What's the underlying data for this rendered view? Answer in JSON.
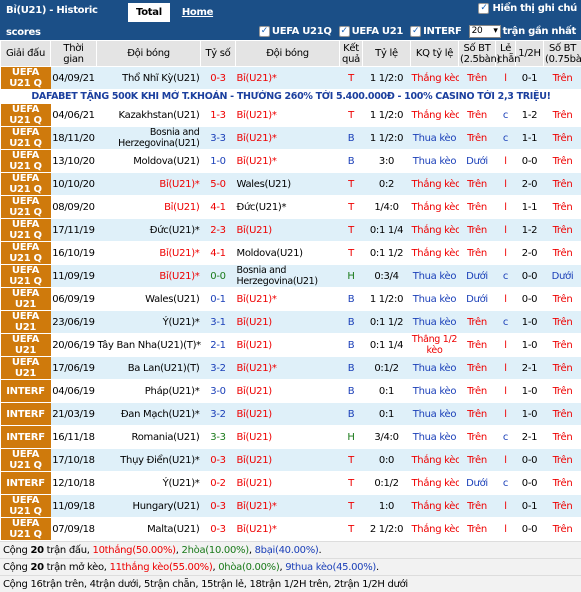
{
  "header": {
    "title": "Bỉ(U21) - Historic scores",
    "tab_total": "Total",
    "tab_home": "Home",
    "show_notes": "Hiển thị ghi chú"
  },
  "filters": {
    "f1": "UEFA U21Q",
    "f2": "UEFA U21",
    "f3": "INTERF",
    "count": "20",
    "count_suffix": "trận gần nhất"
  },
  "columns": [
    "Giải đấu",
    "Thời gian",
    "Đội bóng",
    "Tỷ số",
    "Đội bóng",
    "Kết quả",
    "Tỷ lệ",
    "KQ tỷ lệ",
    "Số BT (2.5bàn)",
    "Lẻ chẵn",
    "1/2H",
    "Số BT (0.75bàn)"
  ],
  "ad_text": "DAFABET TẶNG 500K KHI MỞ T.KHOẢN - THƯỞNG 260% TỚI 5.400.000Đ - 100% CASINO TỚI 2,3 TRIỆU!",
  "rows": [
    {
      "league": "UEFA U21 Q",
      "date": "04/09/21",
      "home": "Thổ Nhĩ Kỳ(U21)",
      "score": "0-3",
      "away": "Bỉ(U21)*",
      "res": "T",
      "odds": "1 1/2:0",
      "kq": "Thắng kèo",
      "bt": "Trên",
      "lc": "l",
      "h1": "0-1",
      "bt2": "Trên"
    },
    {
      "league": "UEFA U21 Q",
      "date": "04/06/21",
      "home": "Kazakhstan(U21)",
      "score": "1-3",
      "away": "Bỉ(U21)*",
      "res": "T",
      "odds": "1 1/2:0",
      "kq": "Thắng kèo",
      "bt": "Trên",
      "lc": "c",
      "h1": "1-2",
      "bt2": "Trên"
    },
    {
      "league": "UEFA U21 Q",
      "date": "18/11/20",
      "home": "Bosnia and Herzegovina(U21)",
      "score": "3-3",
      "away": "Bỉ(U21)*",
      "res": "B",
      "odds": "1 1/2:0",
      "kq": "Thua kèo",
      "bt": "Trên",
      "lc": "c",
      "h1": "1-1",
      "bt2": "Trên"
    },
    {
      "league": "UEFA U21 Q",
      "date": "13/10/20",
      "home": "Moldova(U21)",
      "score": "1-0",
      "away": "Bỉ(U21)*",
      "res": "B",
      "odds": "3:0",
      "kq": "Thua kèo",
      "bt": "Dưới",
      "lc": "l",
      "h1": "0-0",
      "bt2": "Trên"
    },
    {
      "league": "UEFA U21 Q",
      "date": "10/10/20",
      "home": "Bỉ(U21)*",
      "score": "5-0",
      "away": "Wales(U21)",
      "res": "T",
      "odds": "0:2",
      "kq": "Thắng kèo",
      "bt": "Trên",
      "lc": "l",
      "h1": "2-0",
      "bt2": "Trên"
    },
    {
      "league": "UEFA U21 Q",
      "date": "08/09/20",
      "home": "Bỉ(U21)",
      "score": "4-1",
      "away": "Đức(U21)*",
      "res": "T",
      "odds": "1/4:0",
      "kq": "Thắng kèo",
      "bt": "Trên",
      "lc": "l",
      "h1": "1-1",
      "bt2": "Trên"
    },
    {
      "league": "UEFA U21 Q",
      "date": "17/11/19",
      "home": "Đức(U21)*",
      "score": "2-3",
      "away": "Bỉ(U21)",
      "res": "T",
      "odds": "0:1 1/4",
      "kq": "Thắng kèo",
      "bt": "Trên",
      "lc": "l",
      "h1": "1-2",
      "bt2": "Trên"
    },
    {
      "league": "UEFA U21 Q",
      "date": "16/10/19",
      "home": "Bỉ(U21)*",
      "score": "4-1",
      "away": "Moldova(U21)",
      "res": "T",
      "odds": "0:1 1/2",
      "kq": "Thắng kèo",
      "bt": "Trên",
      "lc": "l",
      "h1": "2-0",
      "bt2": "Trên"
    },
    {
      "league": "UEFA U21 Q",
      "date": "11/09/19",
      "home": "Bỉ(U21)*",
      "score": "0-0",
      "away": "Bosnia and Herzegovina(U21)",
      "res": "H",
      "odds": "0:3/4",
      "kq": "Thua kèo",
      "bt": "Dưới",
      "lc": "c",
      "h1": "0-0",
      "bt2": "Dưới"
    },
    {
      "league": "UEFA U21",
      "date": "06/09/19",
      "home": "Wales(U21)",
      "score": "0-1",
      "away": "Bỉ(U21)*",
      "res": "B",
      "odds": "1 1/2:0",
      "kq": "Thua kèo",
      "bt": "Dưới",
      "lc": "l",
      "h1": "0-0",
      "bt2": "Trên"
    },
    {
      "league": "UEFA U21",
      "date": "23/06/19",
      "home": "Ý(U21)*",
      "score": "3-1",
      "away": "Bỉ(U21)",
      "res": "B",
      "odds": "0:1 1/2",
      "kq": "Thua kèo",
      "bt": "Trên",
      "lc": "c",
      "h1": "1-0",
      "bt2": "Trên"
    },
    {
      "league": "UEFA U21",
      "date": "20/06/19",
      "home": "Tây Ban Nha(U21)(T)*",
      "score": "2-1",
      "away": "Bỉ(U21)",
      "res": "B",
      "odds": "0:1 1/4",
      "kq": "Thắng 1/2 kèo",
      "bt": "Trên",
      "lc": "l",
      "h1": "1-0",
      "bt2": "Trên"
    },
    {
      "league": "UEFA U21",
      "date": "17/06/19",
      "home": "Ba Lan(U21)(T)",
      "score": "3-2",
      "away": "Bỉ(U21)*",
      "res": "B",
      "odds": "0:1/2",
      "kq": "Thua kèo",
      "bt": "Trên",
      "lc": "l",
      "h1": "2-1",
      "bt2": "Trên"
    },
    {
      "league": "INTERF",
      "date": "04/06/19",
      "home": "Pháp(U21)*",
      "score": "3-0",
      "away": "Bỉ(U21)",
      "res": "B",
      "odds": "0:1",
      "kq": "Thua kèo",
      "bt": "Trên",
      "lc": "l",
      "h1": "1-0",
      "bt2": "Trên"
    },
    {
      "league": "INTERF",
      "date": "21/03/19",
      "home": "Đan Mạch(U21)*",
      "score": "3-2",
      "away": "Bỉ(U21)",
      "res": "B",
      "odds": "0:1",
      "kq": "Thua kèo",
      "bt": "Trên",
      "lc": "l",
      "h1": "1-0",
      "bt2": "Trên"
    },
    {
      "league": "INTERF",
      "date": "16/11/18",
      "home": "Romania(U21)",
      "score": "3-3",
      "away": "Bỉ(U21)",
      "res": "H",
      "odds": "3/4:0",
      "kq": "Thua kèo",
      "bt": "Trên",
      "lc": "c",
      "h1": "2-1",
      "bt2": "Trên"
    },
    {
      "league": "UEFA U21 Q",
      "date": "17/10/18",
      "home": "Thụy Điển(U21)*",
      "score": "0-3",
      "away": "Bỉ(U21)",
      "res": "T",
      "odds": "0:0",
      "kq": "Thắng kèo",
      "bt": "Trên",
      "lc": "l",
      "h1": "0-0",
      "bt2": "Trên"
    },
    {
      "league": "INTERF",
      "date": "12/10/18",
      "home": "Ý(U21)*",
      "score": "0-2",
      "away": "Bỉ(U21)",
      "res": "T",
      "odds": "0:1/2",
      "kq": "Thắng kèo",
      "bt": "Dưới",
      "lc": "c",
      "h1": "0-0",
      "bt2": "Trên"
    },
    {
      "league": "UEFA U21 Q",
      "date": "11/09/18",
      "home": "Hungary(U21)",
      "score": "0-3",
      "away": "Bỉ(U21)*",
      "res": "T",
      "odds": "1:0",
      "kq": "Thắng kèo",
      "bt": "Trên",
      "lc": "l",
      "h1": "0-1",
      "bt2": "Trên"
    },
    {
      "league": "UEFA U21 Q",
      "date": "07/09/18",
      "home": "Malta(U21)",
      "score": "0-3",
      "away": "Bỉ(U21)*",
      "res": "T",
      "odds": "2 1/2:0",
      "kq": "Thắng kèo",
      "bt": "Trên",
      "lc": "l",
      "h1": "0-0",
      "bt2": "Trên"
    }
  ],
  "summary": {
    "line1": {
      "pre": "Cộng ",
      "n": "20",
      "mid": " trận đấu, ",
      "w": "10thắng(50.00%)",
      "s1": ", ",
      "d": "2hòa(10.00%)",
      "s2": ", ",
      "l": "8bại(40.00%)",
      "end": "."
    },
    "line2": {
      "pre": "Cộng ",
      "n": "20",
      "mid": " trận mở kèo, ",
      "w": "11thắng kèo(55.00%)",
      "s1": ", ",
      "d": "0hòa(0.00%)",
      "s2": ", ",
      "l": "9thua kèo(45.00%)",
      "end": "."
    },
    "line3": "Cộng 16trận trên, 4trận dưới, 5trận chẵn, 15trận lẻ, 18trận 1/2H trên, 2trận 1/2H dưới"
  }
}
